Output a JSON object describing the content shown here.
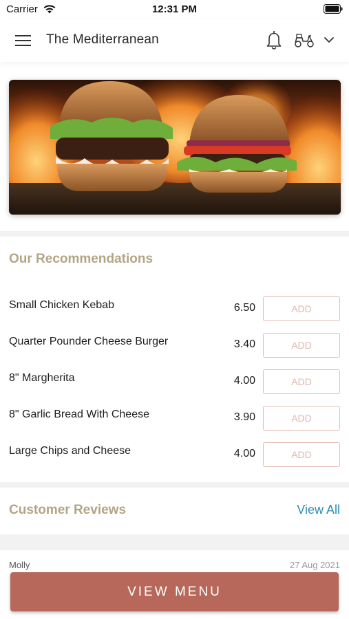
{
  "status_bar": {
    "carrier": "Carrier",
    "time": "12:31 PM"
  },
  "header": {
    "title": "The Mediterranean",
    "icons": [
      "menu-icon",
      "bell-icon",
      "scooter-icon",
      "chevron-down-icon"
    ]
  },
  "hero": {
    "image": "burger-photo"
  },
  "recommendations": {
    "title": "Our Recommendations",
    "items": [
      {
        "name": "Small Chicken Kebab",
        "price": "6.50",
        "action": "ADD"
      },
      {
        "name": "Quarter Pounder Cheese Burger",
        "price": "3.40",
        "action": "ADD"
      },
      {
        "name": "8\" Margherita",
        "price": "4.00",
        "action": "ADD"
      },
      {
        "name": "8\" Garlic Bread With Cheese",
        "price": "3.90",
        "action": "ADD"
      },
      {
        "name": "Large Chips and Cheese",
        "price": "4.00",
        "action": "ADD"
      }
    ]
  },
  "reviews": {
    "title": "Customer Reviews",
    "view_all": "View All",
    "first": {
      "name": "Molly",
      "date": "27 Aug 2021"
    }
  },
  "footer": {
    "view_menu": "VIEW MENU"
  },
  "colors": {
    "accent": "#b7685a",
    "section_title": "#b3a584",
    "link": "#2a8fb4",
    "add_border": "#e2bcb3"
  }
}
